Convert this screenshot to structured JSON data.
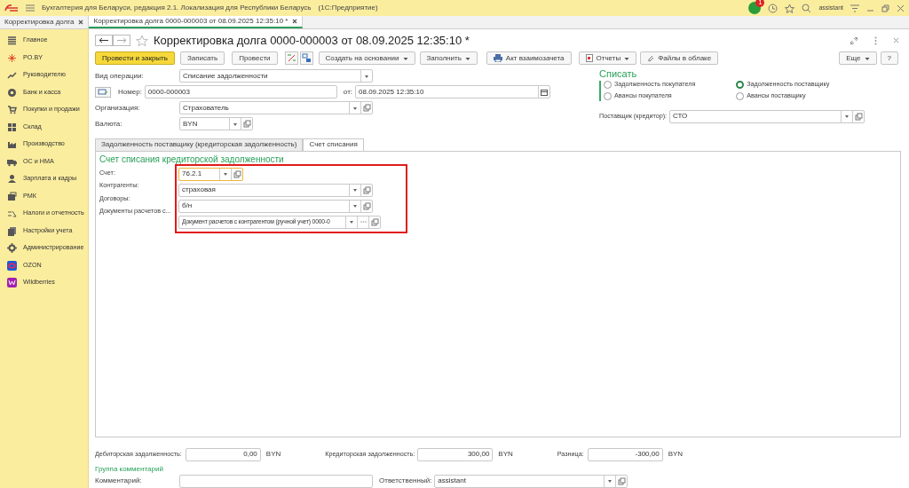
{
  "window": {
    "title": "Бухгалтерия для Беларуси, редакция 2.1. Локализация для Республики Беларусь",
    "app": "(1С:Предприятие)",
    "user": "assistant",
    "notification_count": "1"
  },
  "open_tabs": [
    {
      "label": "Корректировка долга",
      "selected": false
    },
    {
      "label": "Корректировка долга 0000-000003 от 08.09.2025 12:35:10 *",
      "selected": true
    }
  ],
  "sidebar": {
    "items": [
      {
        "label": "Главное"
      },
      {
        "label": "PO.BY"
      },
      {
        "label": "Руководителю"
      },
      {
        "label": "Банк и касса"
      },
      {
        "label": "Покупки и продажи"
      },
      {
        "label": "Склад"
      },
      {
        "label": "Производство"
      },
      {
        "label": "ОС и НМА"
      },
      {
        "label": "Зарплата и кадры"
      },
      {
        "label": "РМК"
      },
      {
        "label": "Налоги и отчетность"
      },
      {
        "label": "Настройки учета"
      },
      {
        "label": "Администрирование"
      },
      {
        "label": "OZON"
      },
      {
        "label": "Wildberries"
      }
    ]
  },
  "document": {
    "title": "Корректировка долга 0000-000003 от 08.09.2025 12:35:10 *",
    "toolbar": [
      {
        "kind": "primary",
        "label": "Провести и закрыть"
      },
      {
        "kind": "button",
        "label": "Записать"
      },
      {
        "kind": "button",
        "label": "Провести"
      },
      {
        "kind": "dtkt"
      },
      {
        "kind": "structure"
      },
      {
        "kind": "menu",
        "label": "Создать на основании"
      },
      {
        "kind": "menu",
        "label": "Заполнить"
      },
      {
        "kind": "print",
        "label": "Акт взаимозачета"
      },
      {
        "kind": "report",
        "label": "Отчеты"
      },
      {
        "kind": "clip",
        "label": "Файлы в облаке"
      }
    ],
    "more": {
      "label": "Еще"
    },
    "help": {
      "label": "?"
    },
    "operation_type": {
      "label": "Вид операции:",
      "value": "Списание задолженности"
    },
    "number": {
      "label": "Номер:",
      "value": "0000-000003"
    },
    "date": {
      "label": "от:",
      "value": "08.09.2025 12:35:10"
    },
    "organization": {
      "label": "Организация:",
      "value": "Страхователь"
    },
    "currency": {
      "label": "Валюта:",
      "value": "BYN"
    },
    "writeoff": {
      "title": "Списать",
      "options": [
        {
          "label": "Задолженность покупателя",
          "selected": false
        },
        {
          "label": "Задолженность поставщику",
          "selected": true
        },
        {
          "label": "Авансы покупателя",
          "selected": false
        },
        {
          "label": "Авансы поставщику",
          "selected": false
        }
      ]
    },
    "supplier": {
      "label": "Поставщик (кредитор):",
      "value": "СТО"
    },
    "form_tabs": [
      {
        "label": "Задолженность поставщику (кредиторская задолженность)",
        "selected": false
      },
      {
        "label": "Счет списания",
        "selected": true
      }
    ],
    "writeoff_account": {
      "title": "Счет списания кредиторской задолженности",
      "fields": [
        {
          "label": "Счет:",
          "value": "76.2.1",
          "kind": "short",
          "focused": true
        },
        {
          "label": "Контрагенты:",
          "value": "страховая",
          "kind": "select",
          "focused": false
        },
        {
          "label": "Договоры:",
          "value": "б/н",
          "kind": "select",
          "focused": false
        },
        {
          "label": "Документы расчетов с...",
          "value": "Документ расчетов с контрагентом (ручной учет) 0000-0",
          "kind": "choice",
          "focused": false
        }
      ]
    },
    "totals": [
      {
        "label": "Дебиторская задолженность:",
        "value": "0,00",
        "currency": "BYN"
      },
      {
        "label": "Кредиторская задолженность:",
        "value": "300,00",
        "currency": "BYN"
      },
      {
        "label": "Разница:",
        "value": "-300,00",
        "currency": "BYN"
      }
    ],
    "comments": {
      "title": "Группа комментарий",
      "comment_label": "Комментарий:",
      "responsible": {
        "label": "Ответственный:",
        "value": "assistant"
      }
    }
  }
}
